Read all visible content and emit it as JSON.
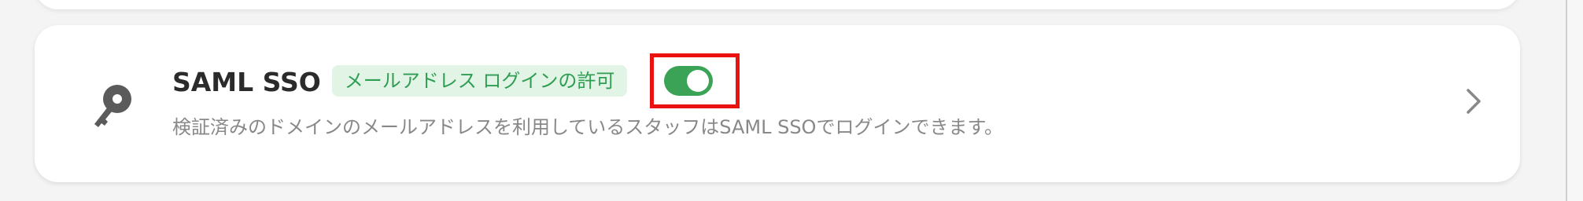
{
  "sso_card": {
    "title": "SAML SSO",
    "badge": "メールアドレス ログインの許可",
    "toggle": {
      "on": true,
      "color": "#3aa356"
    },
    "description": "検証済みのドメインのメールアドレスを利用しているスタッフはSAML SSOでログインできます。",
    "icon": "key-icon"
  },
  "colors": {
    "badge_text": "#2f9d52",
    "badge_bg": "#e1f4e5",
    "highlight": "#ea1111"
  }
}
